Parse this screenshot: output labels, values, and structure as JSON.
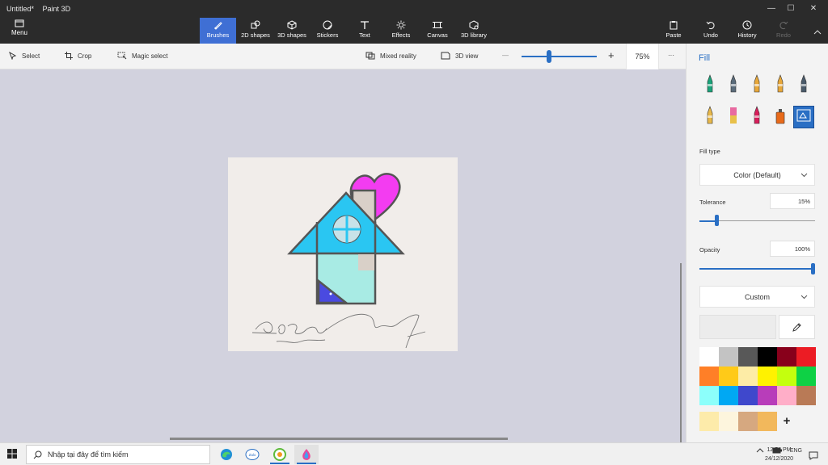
{
  "window": {
    "doc_name": "Untitled*",
    "app_name": "Paint 3D",
    "minimize": "—",
    "maximize": "☐",
    "close": "✕",
    "collapse": "︿"
  },
  "menu": {
    "label": "Menu"
  },
  "tools": [
    {
      "label": "Brushes"
    },
    {
      "label": "2D shapes"
    },
    {
      "label": "3D shapes"
    },
    {
      "label": "Stickers"
    },
    {
      "label": "Text"
    },
    {
      "label": "Effects"
    },
    {
      "label": "Canvas"
    },
    {
      "label": "3D library"
    }
  ],
  "actions": {
    "paste": "Paste",
    "undo": "Undo",
    "history": "History",
    "redo": "Redo"
  },
  "toolbar2": {
    "select": "Select",
    "crop": "Crop",
    "magic_select": "Magic select",
    "mixed_reality": "Mixed reality",
    "view_3d": "3D view",
    "zoom_minus": "—",
    "zoom_plus": "+",
    "zoom_value": "75%",
    "more": "···"
  },
  "panel": {
    "title": "Fill",
    "fill_type_label": "Fill type",
    "fill_type_value": "Color (Default)",
    "tolerance_label": "Tolerance",
    "tolerance_value": "15%",
    "tolerance_level": 0.15,
    "opacity_label": "Opacity",
    "opacity_value": "100%",
    "opacity_level": 1.0,
    "color_mode": "Custom",
    "palette": [
      "#ffffff",
      "#c3c3c3",
      "#585858",
      "#000000",
      "#88001b",
      "#ec1c24",
      "#ff7f27",
      "#ffca18",
      "#fdeca6",
      "#fff200",
      "#c4ff0e",
      "#0ed145",
      "#8cfffb",
      "#00a8f3",
      "#3f48cc",
      "#b83dba",
      "#ffaec8",
      "#b97a56"
    ],
    "custom_colors": [
      "#fdebaa",
      "#fdf5dd",
      "#d6a880",
      "#f2b85c"
    ],
    "add_color": "+",
    "brushes": [
      {
        "icon": "marker-icon",
        "color": "#1aa37a"
      },
      {
        "icon": "calligraphy-pen-icon",
        "color": "#5a6b7a"
      },
      {
        "icon": "oil-brush-icon",
        "color": "#e8a83a"
      },
      {
        "icon": "watercolor-icon",
        "color": "#e8a83a"
      },
      {
        "icon": "pixel-pen-icon",
        "color": "#4a5a6a"
      },
      {
        "icon": "pencil-icon",
        "color": "#e8b84a"
      },
      {
        "icon": "eraser-icon",
        "color": "#e86aa0"
      },
      {
        "icon": "crayon-icon",
        "color": "#d81e5b"
      },
      {
        "icon": "spray-can-icon",
        "color": "#e86a1a"
      },
      {
        "icon": "fill-bucket-icon",
        "color": "#2a6fc4"
      }
    ]
  },
  "taskbar": {
    "search_placeholder": "Nhập tại đây để tìm kiếm",
    "zalo": "Zalo",
    "lang": "ENG",
    "time": "12:54 PM",
    "date": "24/12/2020"
  }
}
